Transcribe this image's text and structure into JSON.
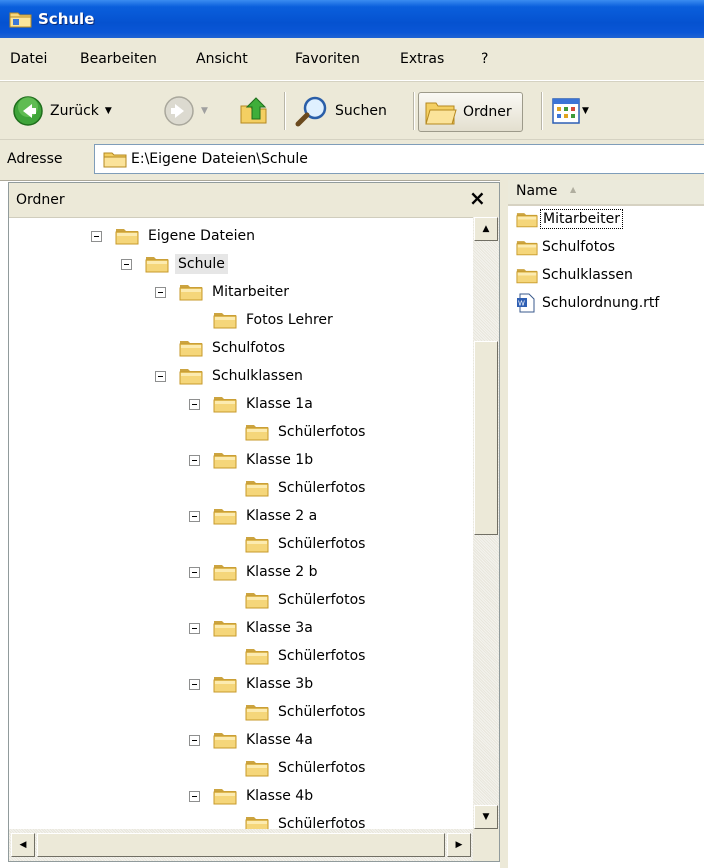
{
  "window": {
    "title": "Schule"
  },
  "menu": [
    "Datei",
    "Bearbeiten",
    "Ansicht",
    "Favoriten",
    "Extras",
    "?"
  ],
  "toolbar": {
    "back_label": "Zurück",
    "search_label": "Suchen",
    "folders_label": "Ordner"
  },
  "address": {
    "label": "Adresse",
    "value": "E:\\Eigene Dateien\\Schule"
  },
  "folder_pane": {
    "title": "Ordner",
    "close_glyph": "×",
    "tree": [
      {
        "label": "Eigene Dateien",
        "level": 0,
        "expanded": true
      },
      {
        "label": "Schule",
        "level": 1,
        "expanded": true,
        "selected": true
      },
      {
        "label": "Mitarbeiter",
        "level": 2,
        "expanded": true
      },
      {
        "label": "Fotos Lehrer",
        "level": 3
      },
      {
        "label": "Schulfotos",
        "level": 2
      },
      {
        "label": "Schulklassen",
        "level": 2,
        "expanded": true
      },
      {
        "label": "Klasse 1a",
        "level": 3,
        "expanded": true
      },
      {
        "label": "Schülerfotos",
        "level": 4
      },
      {
        "label": "Klasse 1b",
        "level": 3,
        "expanded": true
      },
      {
        "label": "Schülerfotos",
        "level": 4
      },
      {
        "label": "Klasse 2 a",
        "level": 3,
        "expanded": true
      },
      {
        "label": "Schülerfotos",
        "level": 4
      },
      {
        "label": "Klasse 2 b",
        "level": 3,
        "expanded": true
      },
      {
        "label": "Schülerfotos",
        "level": 4
      },
      {
        "label": "Klasse 3a",
        "level": 3,
        "expanded": true
      },
      {
        "label": "Schülerfotos",
        "level": 4
      },
      {
        "label": "Klasse 3b",
        "level": 3,
        "expanded": true
      },
      {
        "label": "Schülerfotos",
        "level": 4
      },
      {
        "label": "Klasse 4a",
        "level": 3,
        "expanded": true
      },
      {
        "label": "Schülerfotos",
        "level": 4
      },
      {
        "label": "Klasse 4b",
        "level": 3,
        "expanded": true
      },
      {
        "label": "Schülerfotos",
        "level": 4
      }
    ]
  },
  "file_list": {
    "column": "Name",
    "items": [
      {
        "name": "Mitarbeiter",
        "type": "folder",
        "focused": true
      },
      {
        "name": "Schulfotos",
        "type": "folder"
      },
      {
        "name": "Schulklassen",
        "type": "folder"
      },
      {
        "name": "Schulordnung.rtf",
        "type": "document"
      }
    ]
  },
  "colors": {
    "titlebar": "#0552d0",
    "chrome": "#ece9d8",
    "folder_fill": "#f5d67a",
    "folder_edge": "#c79a2b"
  }
}
